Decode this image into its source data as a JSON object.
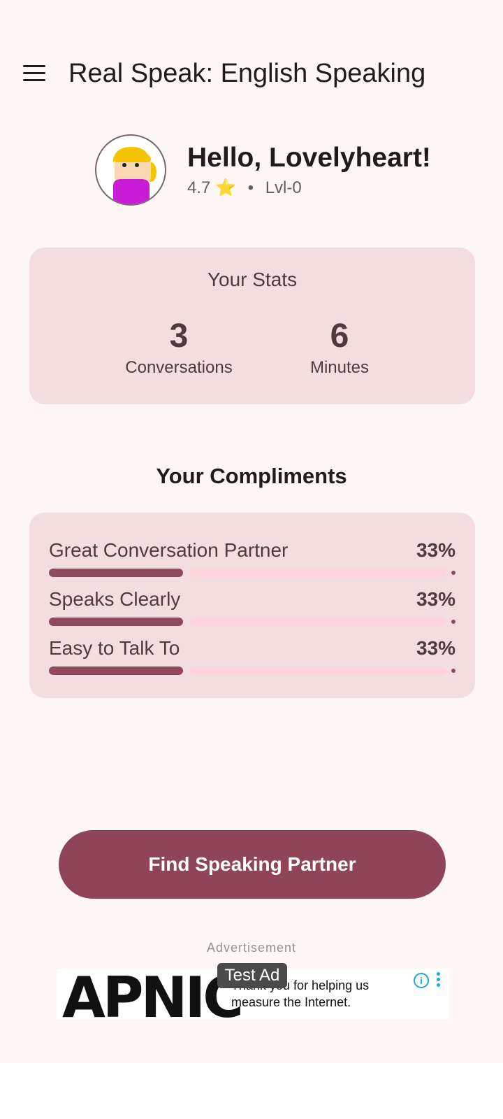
{
  "app": {
    "title": "Real Speak: English Speaking"
  },
  "profile": {
    "greeting": "Hello, Lovelyheart!",
    "rating": "4.7",
    "star": "⭐",
    "separator": "•",
    "level": "Lvl-0"
  },
  "stats": {
    "title": "Your Stats",
    "items": [
      {
        "value": "3",
        "label": "Conversations"
      },
      {
        "value": "6",
        "label": "Minutes"
      }
    ]
  },
  "compliments": {
    "heading": "Your Compliments",
    "items": [
      {
        "label": "Great Conversation Partner",
        "percent_text": "33%",
        "progress": 0.33
      },
      {
        "label": "Speaks Clearly",
        "percent_text": "33%",
        "progress": 0.33
      },
      {
        "label": "Easy to Talk To",
        "percent_text": "33%",
        "progress": 0.33
      }
    ]
  },
  "actions": {
    "find_partner": "Find Speaking Partner"
  },
  "ad": {
    "label": "Advertisement",
    "badge": "Test Ad",
    "logo": "APNIC",
    "text": "Thank you for helping us measure the Internet.",
    "info_icon": "info-icon",
    "more_icon": "more-vert-icon"
  },
  "colors": {
    "primary": "#904556",
    "card": "#F4DDDF",
    "background": "#FFF7F5",
    "progress_track": "#FDD3DC",
    "ad_accent": "#1BA7E0"
  }
}
